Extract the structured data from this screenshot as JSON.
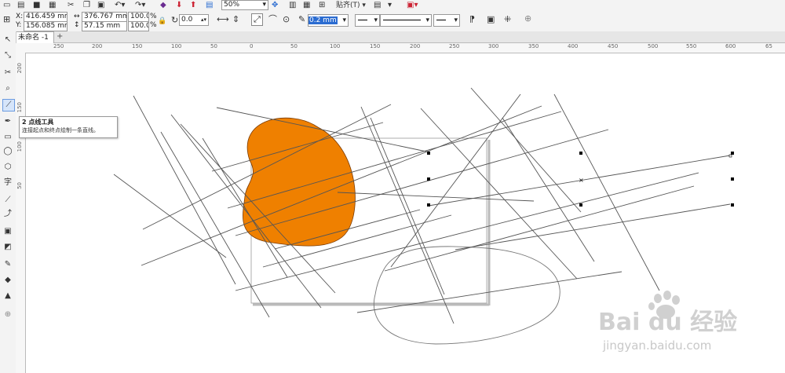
{
  "toolbar": {
    "zoom_value": "50%",
    "snap_label": "贴齐(T)"
  },
  "property_bar": {
    "x_label": "X:",
    "x_value": "416.459 mm",
    "y_label": "Y:",
    "y_value": "156.085 mm",
    "width_value": "376.767 mm",
    "height_value": "57.15 mm",
    "scale_x_value": "100.0",
    "scale_y_value": "100.0",
    "percent_sign": "%",
    "rotation_value": "0.0",
    "outline_width_value": "0.2 mm"
  },
  "tabs": {
    "document_tab": "未命名 -1",
    "add_tab": "+"
  },
  "ruler": {
    "h_labels": [
      "250",
      "200",
      "150",
      "100",
      "50",
      "0",
      "50",
      "100",
      "150",
      "200",
      "250",
      "300",
      "350",
      "400",
      "450",
      "500",
      "550",
      "600",
      "65"
    ],
    "v_labels": [
      "200",
      "150",
      "100",
      "50"
    ]
  },
  "tooltip": {
    "title": "2 点线工具",
    "description": "连接起点和终点绘制一条直线。"
  },
  "watermark": {
    "brand": "Bai du 经验",
    "url": "jingyan.baidu.com"
  },
  "colors": {
    "orange_fill": "#ef8000",
    "orange_stroke": "#7a3a00",
    "line_color": "#555555",
    "selection_blue": "#2b6cd1"
  }
}
